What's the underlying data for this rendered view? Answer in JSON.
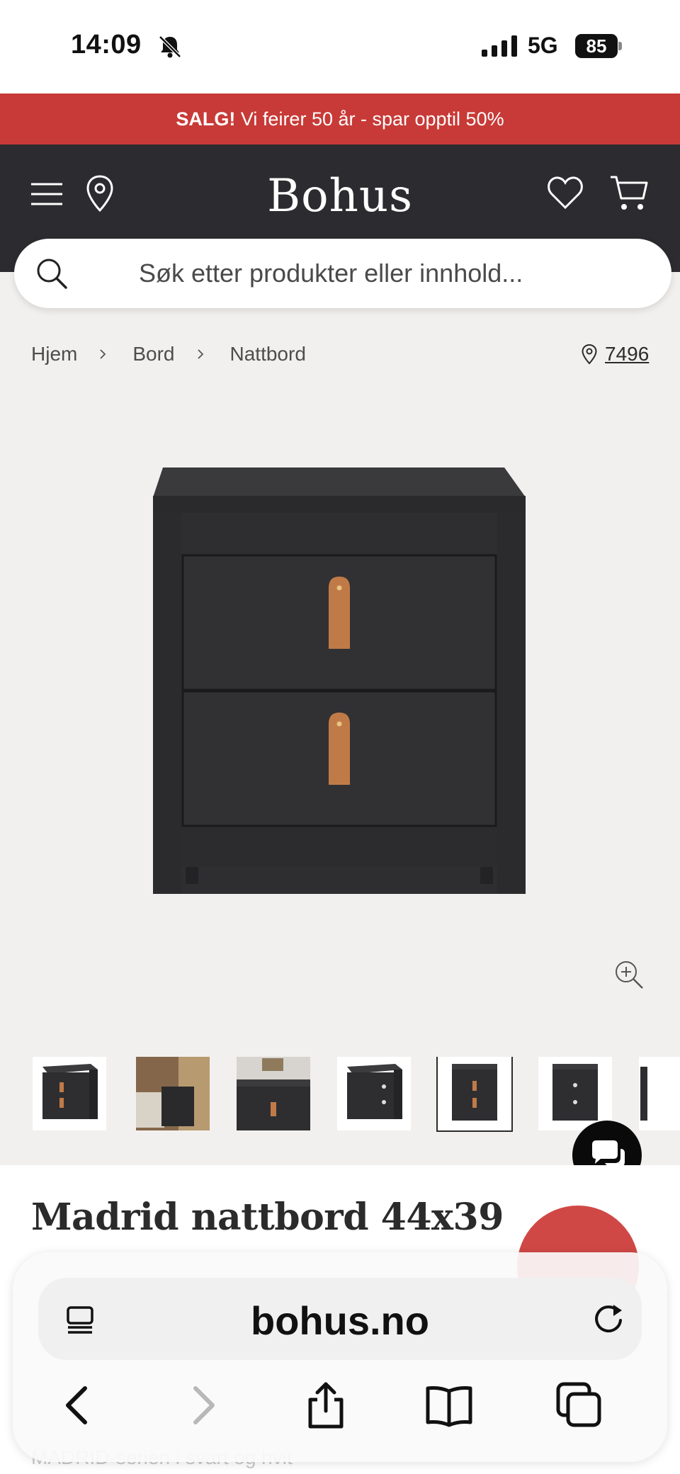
{
  "status_bar": {
    "time": "14:09",
    "network": "5G",
    "battery": "85"
  },
  "sale_banner": {
    "bold": "SALG!",
    "text": " Vi feirer 50 år - spar opptil 50%"
  },
  "header": {
    "logo": "Bohus"
  },
  "search": {
    "placeholder": "Søk etter produkter eller innhold..."
  },
  "breadcrumb": {
    "items": [
      "Hjem",
      "Bord",
      "Nattbord"
    ]
  },
  "store": {
    "number": "7496"
  },
  "product": {
    "title": "Madrid nattbord 44x39",
    "subtitle_partial": "MADRID-serien i svart og hvit"
  },
  "thumbnails": {
    "count": 7,
    "active_index": 4
  },
  "safari": {
    "url": "bohus.no"
  },
  "colors": {
    "accent_red": "#c83a37",
    "header_dark": "#2c2c30",
    "background": "#f2f0ee",
    "product_black": "#2e2e31",
    "leather_handle": "#c07a47"
  },
  "icons": [
    "bell-slash-icon",
    "signal-icon",
    "battery-icon",
    "hamburger-menu-icon",
    "location-pin-icon",
    "heart-icon",
    "cart-icon",
    "search-icon",
    "chevron-right-icon",
    "zoom-in-icon",
    "chat-icon",
    "page-menu-icon",
    "reload-icon",
    "back-icon",
    "forward-icon",
    "share-icon",
    "bookmarks-icon",
    "tabs-icon"
  ]
}
